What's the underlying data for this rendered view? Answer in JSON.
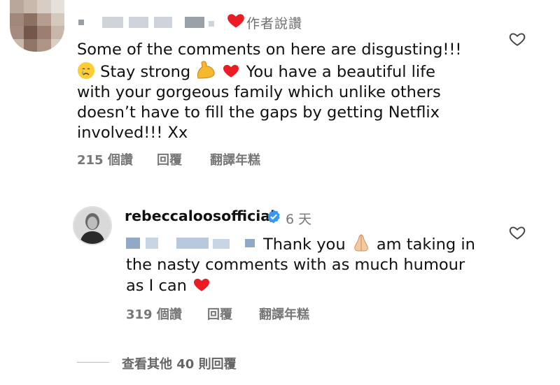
{
  "comment": {
    "author_liked": "作者說讚",
    "text_lines": [
      "Some of the comments on here are disgusting!!!",
      "Stay strong",
      "You have a beautiful life",
      "with your gorgeous family which unlike others",
      "doesn’t have to fill the gaps by getting Netflix",
      "involved!!! Xx"
    ],
    "likes": "215 個讚",
    "reply_label": "回覆",
    "translate_label": "翻譯年糕"
  },
  "reply": {
    "username": "rebeccaloosofficial",
    "time": "6 天",
    "text_part1": "Thank you",
    "text_part2": "am taking in",
    "text_line2": "the nasty comments with as much humour",
    "text_line3": "as I can",
    "likes": "319 個讚",
    "reply_label": "回覆",
    "translate_label": "翻譯年糕"
  },
  "view_more": "查看其他 40 則回覆",
  "colors": {
    "heart_red": "#ed1c24",
    "muted_text": "#777777",
    "verified_blue": "#3897f0"
  }
}
